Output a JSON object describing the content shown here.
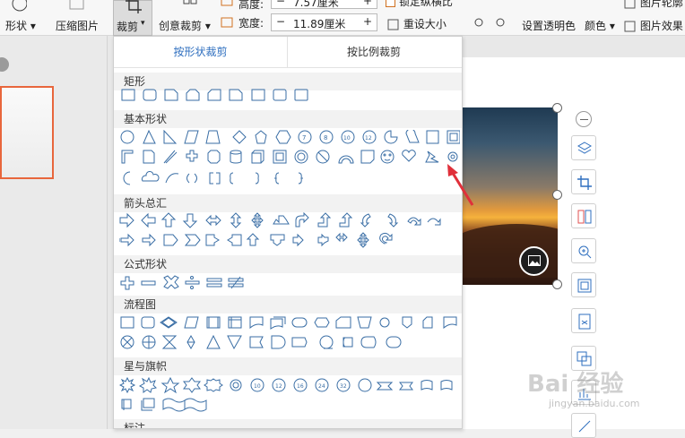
{
  "ribbon": {
    "shape_label": "形状",
    "compress_label": "压缩图片",
    "crop_label": "裁剪",
    "creative_crop_label": "创意裁剪",
    "height_label": "高度:",
    "height_value": "7.57厘米",
    "width_label": "宽度:",
    "width_value": "11.89厘米",
    "lock_ratio_label": "锁定纵横比",
    "reset_size_label": "重设大小",
    "transparent_label": "设置透明色",
    "color_label": "颜色",
    "outline_label": "图片轮廓",
    "effect_label": "图片效果"
  },
  "dropdown": {
    "tab_shape": "按形状裁剪",
    "tab_ratio": "按比例裁剪",
    "sections": {
      "rect": "矩形",
      "basic": "基本形状",
      "arrows": "箭头总汇",
      "formula": "公式形状",
      "flow": "流程图",
      "stars": "星与旗帜",
      "callout": "标注"
    }
  },
  "watermark": {
    "main": "Bai 经验",
    "sub": "jingyan.baidu.com"
  },
  "colors": {
    "accent": "#2f6fbf",
    "shape_stroke": "#3a6ea5",
    "arrow": "#e0303a",
    "thumb_border": "#e8663c"
  }
}
